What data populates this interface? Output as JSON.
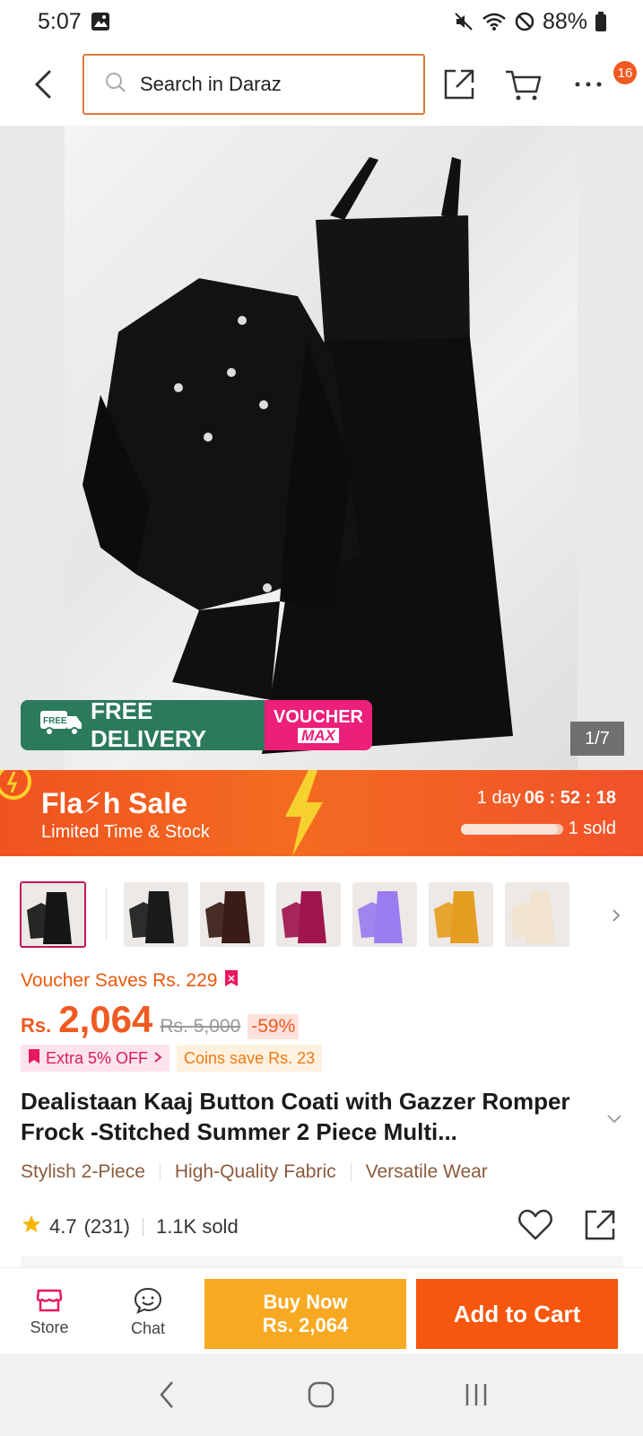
{
  "status_bar": {
    "time": "5:07",
    "battery": "88%"
  },
  "header": {
    "search_placeholder": "Search in Daraz",
    "more_badge": "16"
  },
  "hero": {
    "promo_free": "FREE DELIVERY",
    "promo_free_tag": "FREE",
    "promo_voucher_1": "VOUCHER",
    "promo_voucher_2": "MAX",
    "image_counter": "1/7"
  },
  "flash_sale": {
    "title": "Fla⚡h Sale",
    "subtitle": "Limited Time & Stock",
    "timer_days": "1 day",
    "timer_hms": "06 : 52 : 18",
    "sold": "1 sold",
    "sold_progress": 0.95
  },
  "thumbnails": [
    {
      "color": "#161616",
      "selected": true
    },
    {
      "color": "#1b1b1b",
      "selected": false
    },
    {
      "color": "#3a1c16",
      "selected": false
    },
    {
      "color": "#a0154f",
      "selected": false
    },
    {
      "color": "#9b7bf0",
      "selected": false
    },
    {
      "color": "#e59d21",
      "selected": false
    },
    {
      "color": "#f1e3cf",
      "selected": false
    }
  ],
  "price": {
    "voucher_saves": "Voucher Saves Rs. 229",
    "currency": "Rs.",
    "current": "2,064",
    "original": "Rs. 5,000",
    "discount": "-59%",
    "chip_extra": "Extra 5% OFF",
    "chip_coins": "Coins save Rs. 23"
  },
  "product": {
    "title": "Dealistaan Kaaj Button Coati with Gazzer Romper Frock -Stitched Summer 2 Piece Multi...",
    "tags": [
      "Stylish 2-Piece",
      "High-Quality Fabric",
      "Versatile Wear"
    ],
    "rating": "4.7",
    "reviews": "(231)",
    "sold": "1.1K sold"
  },
  "bottom_bar": {
    "store": "Store",
    "chat": "Chat",
    "buy_now_1": "Buy Now",
    "buy_now_2": "Rs. 2,064",
    "add_to_cart": "Add to Cart"
  },
  "colors": {
    "accent": "#f05a22",
    "buy_now": "#f7a922",
    "add_cart": "#f6560d",
    "search_border": "#e1783a"
  }
}
